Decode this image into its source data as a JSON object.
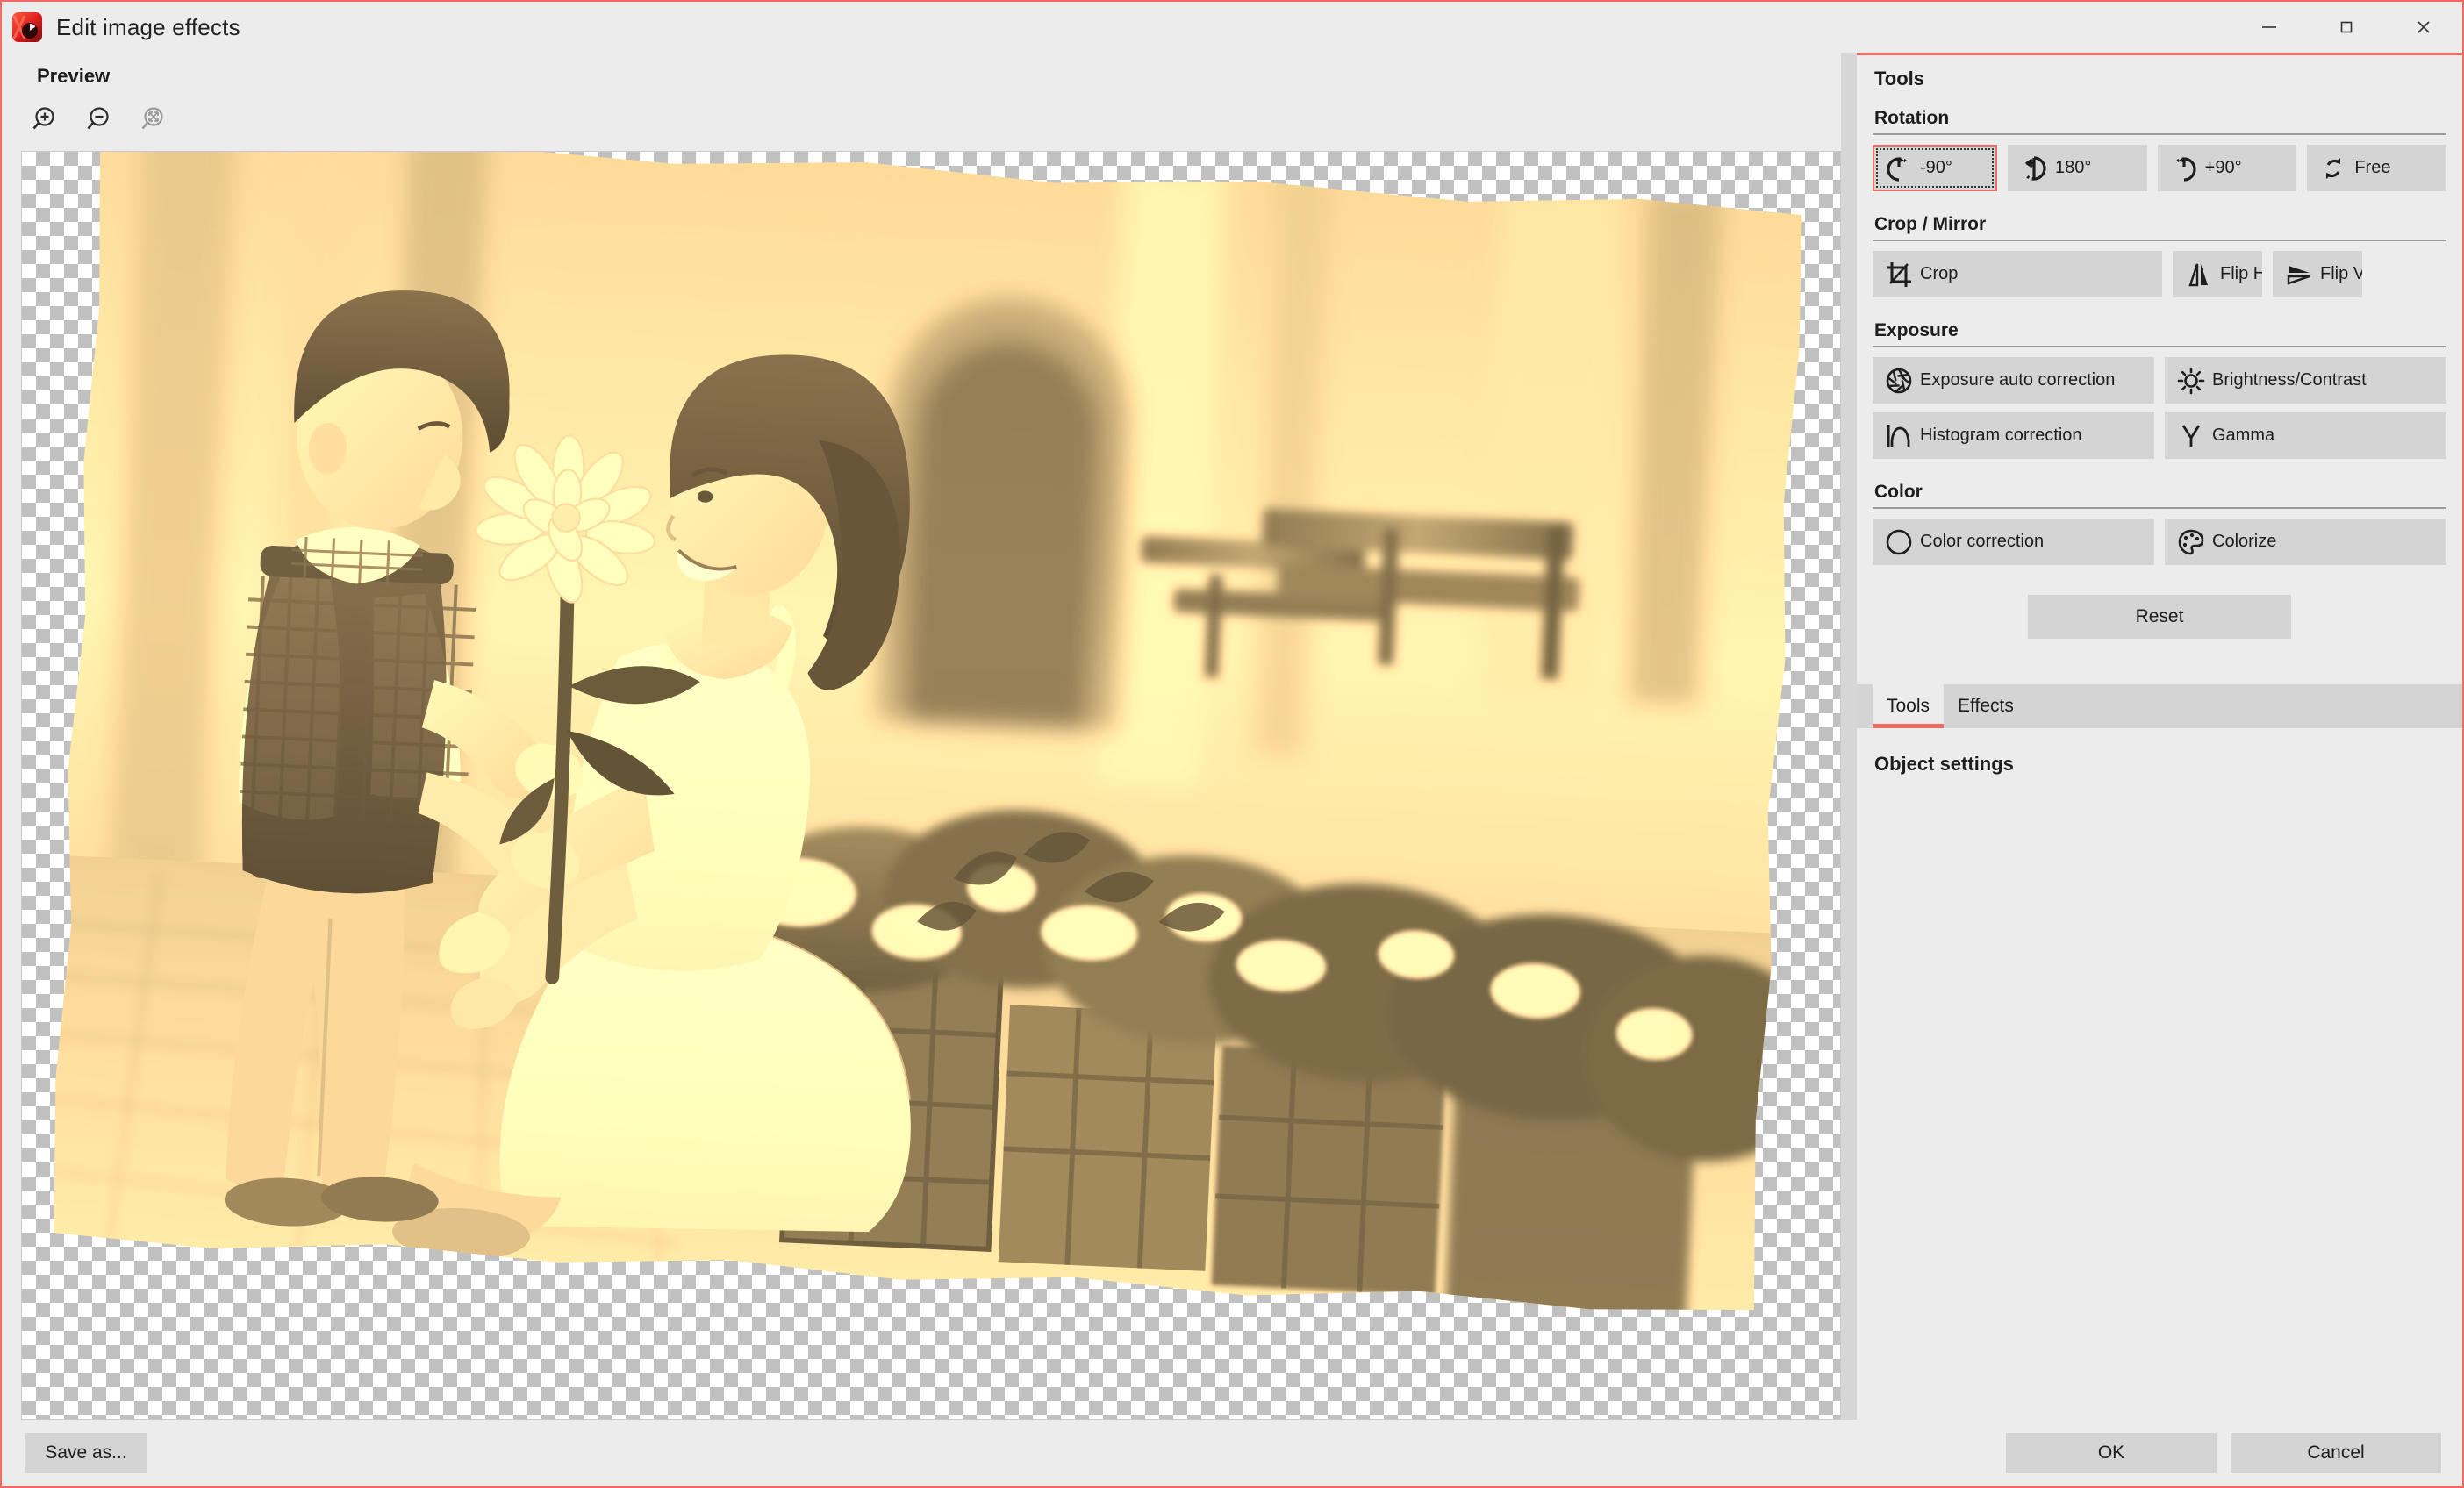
{
  "window": {
    "title": "Edit image effects",
    "icon": "app-logo-icon",
    "accent_color": "#f26a60",
    "panel_bg": "#ececec",
    "button_bg": "#d4d4d4",
    "controls": {
      "minimize": "minimize-icon",
      "maximize": "maximize-icon",
      "close": "close-icon"
    }
  },
  "preview": {
    "label": "Preview",
    "tools": [
      {
        "name": "zoom-in-icon",
        "title": "Zoom in",
        "enabled": true
      },
      {
        "name": "zoom-out-icon",
        "title": "Zoom out",
        "enabled": true
      },
      {
        "name": "fit-to-screen-icon",
        "title": "Fit to screen",
        "enabled": false
      }
    ],
    "canvas": {
      "background": "transparency-checkerboard",
      "checker_light": "#ffffff",
      "checker_dark": "#c0c0c0",
      "checker_size_px": 16,
      "image_rotation_deg": 2.6,
      "image_effect": "sepia",
      "image_edge": "torn-edges",
      "image_description": "Sepia-toned photo of a boy handing a flower to a kneeling woman beside planters of flowers and wooden benches"
    }
  },
  "tools_panel": {
    "title": "Tools",
    "sections": [
      {
        "heading": "Rotation",
        "buttons": [
          {
            "label": "-90°",
            "icon": "rotate-left-icon",
            "focused": true
          },
          {
            "label": "180°",
            "icon": "rotate-180-icon",
            "focused": false
          },
          {
            "label": "+90°",
            "icon": "rotate-right-icon",
            "focused": false
          },
          {
            "label": "Free",
            "icon": "rotate-free-icon",
            "focused": false
          }
        ]
      },
      {
        "heading": "Crop / Mirror",
        "buttons": [
          {
            "label": "Crop",
            "icon": "crop-icon",
            "focused": false
          },
          {
            "label": "Flip H",
            "icon": "flip-horizontal-icon",
            "focused": false
          },
          {
            "label": "Flip V",
            "icon": "flip-vertical-icon",
            "focused": false
          }
        ]
      },
      {
        "heading": "Exposure",
        "buttons": [
          {
            "label": "Exposure auto correction",
            "icon": "aperture-icon",
            "focused": false
          },
          {
            "label": "Brightness/Contrast",
            "icon": "sun-icon",
            "focused": false
          },
          {
            "label": "Histogram correction",
            "icon": "histogram-icon",
            "focused": false
          },
          {
            "label": "Gamma",
            "icon": "gamma-icon",
            "focused": false
          }
        ]
      },
      {
        "heading": "Color",
        "buttons": [
          {
            "label": "Color correction",
            "icon": "contrast-circle-icon",
            "focused": false
          },
          {
            "label": "Colorize",
            "icon": "palette-icon",
            "focused": false
          }
        ]
      }
    ],
    "reset_label": "Reset"
  },
  "tabs": [
    {
      "label": "Tools",
      "active": true
    },
    {
      "label": "Effects",
      "active": false
    }
  ],
  "object_settings": {
    "title": "Object settings"
  },
  "footer": {
    "save_as_label": "Save as...",
    "ok_label": "OK",
    "cancel_label": "Cancel"
  }
}
